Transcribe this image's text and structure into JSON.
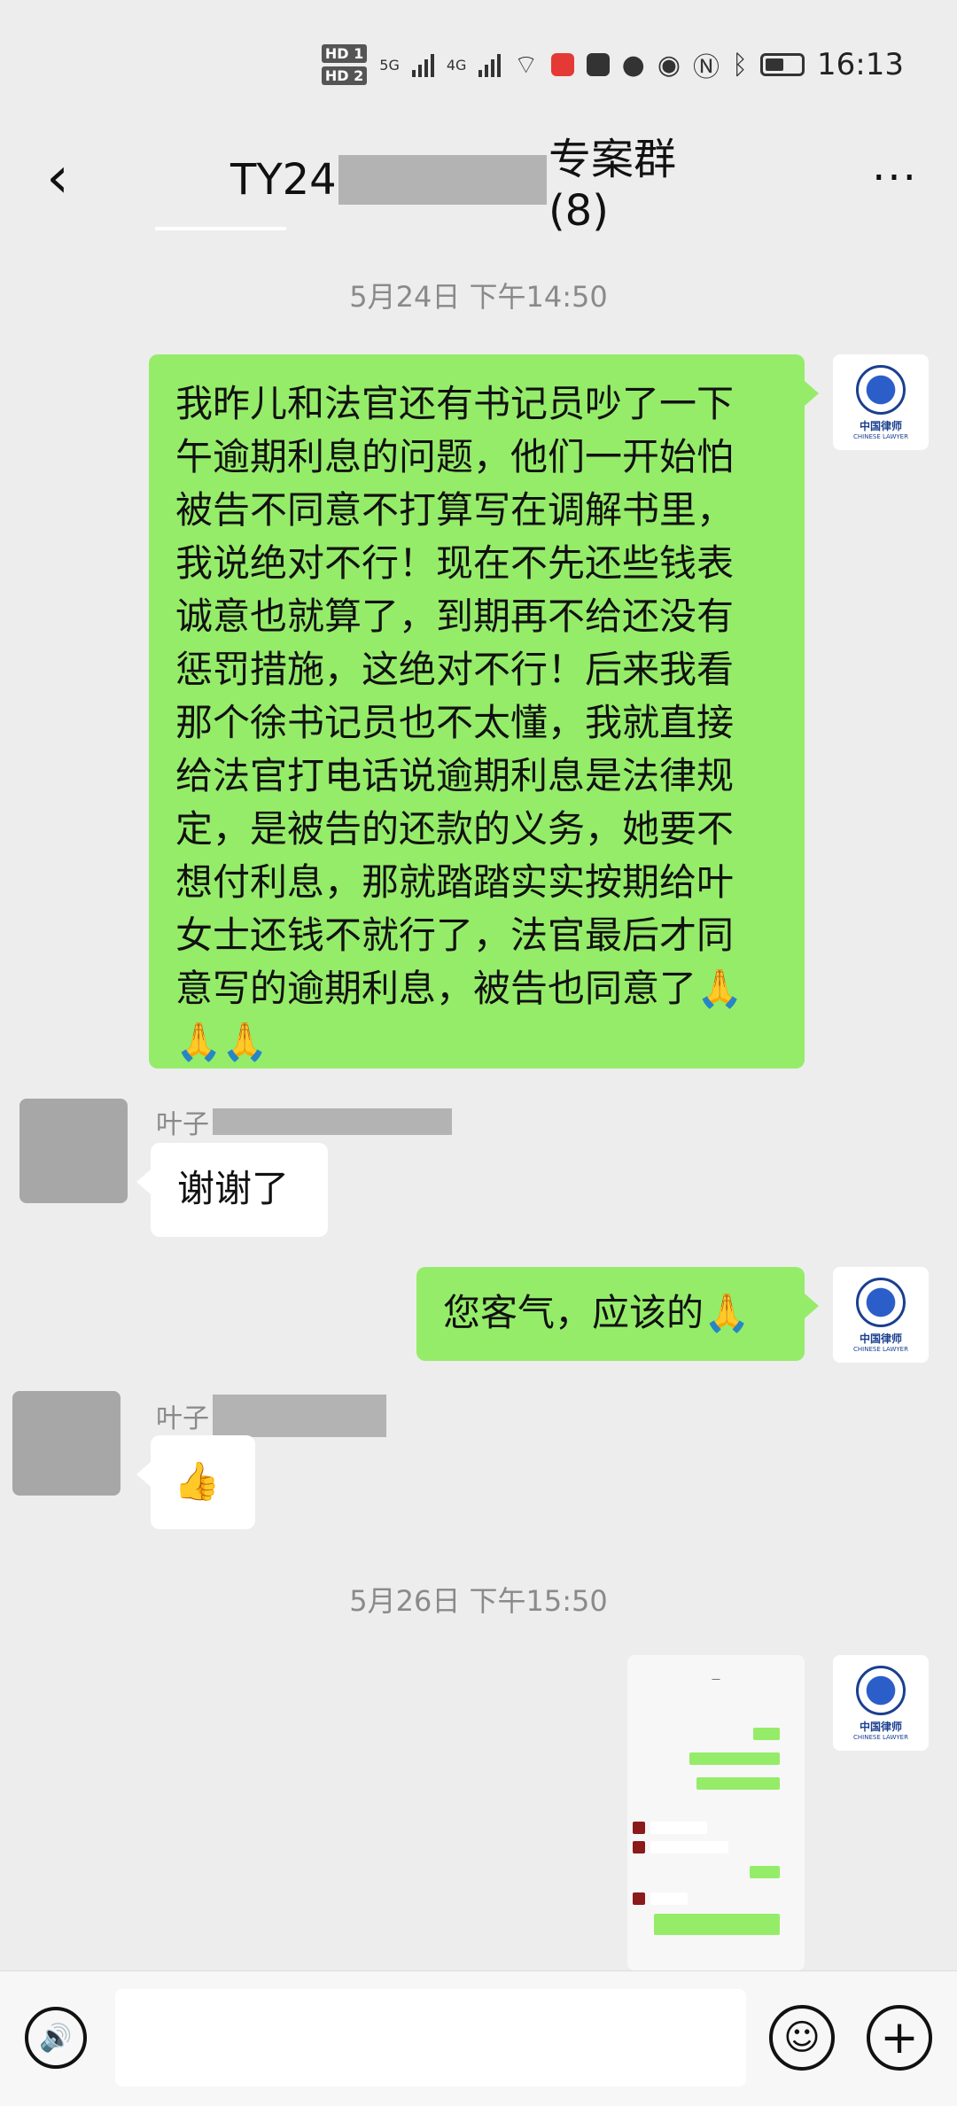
{
  "status_bar": {
    "hd1": "HD 1",
    "hd2": "HD 2",
    "sig1": "5G",
    "sig2": "4G",
    "time": "16:13",
    "icons": [
      "wifi-icon",
      "red-app-icon",
      "dark-app-icon",
      "message-icon",
      "eye-icon",
      "nfc-icon",
      "bluetooth-icon",
      "battery-icon"
    ]
  },
  "nav": {
    "back_icon": "‹",
    "title_prefix": "TY24",
    "title_suffix": "专案群(8)",
    "more_icon": "···"
  },
  "chat": {
    "timestamp_1": "5月24日 下午14:50",
    "msg1": {
      "lines": [
        "我昨儿和法官还有书记员吵了一下",
        "午逾期利息的问题，他们一开始怕",
        "被告不同意不打算写在调解书里，",
        "我说绝对不行！现在不先还些钱表",
        "诚意也就算了，到期再不给还没有",
        "惩罚措施，这绝对不行！后来我看",
        "那个徐书记员也不太懂，我就直接",
        "给法官打电话说逾期利息是法律规",
        "定，是被告的还款的义务，她要不",
        "想付利息，那就踏踏实实按期给叶",
        "女士还钱不就行了，法官最后才同",
        "意写的逾期利息，被告也同意了🙏",
        "🙏🙏"
      ]
    },
    "sender_1": "叶子",
    "msg2": "谢谢了",
    "msg3": "您客气，应该的🙏",
    "sender_2": "叶子",
    "msg4": "👍",
    "timestamp_2": "5月26日 下午15:50",
    "lawyer_avatar": {
      "cn": "中国律师",
      "en": "CHINESE LAWYER"
    }
  },
  "input_bar": {
    "voice_icon": "🔊",
    "emoji_icon": "☺",
    "plus_icon": "+",
    "input_value": ""
  }
}
